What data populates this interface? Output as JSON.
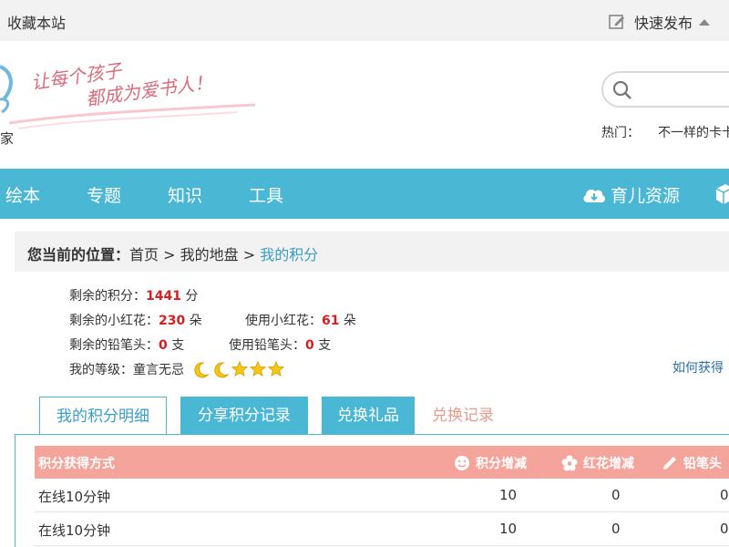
{
  "topbar": {
    "favorite": "收藏本站",
    "quick_post": "快速发布"
  },
  "header": {
    "logo_char": "家",
    "slogan_line1": "让每个孩子",
    "slogan_line2": "都成为爱书人！",
    "search_placeholder": "",
    "hot_label": "热门：",
    "hot_items": [
      "不一样的卡卡"
    ]
  },
  "nav": {
    "items": [
      "绘本",
      "专题",
      "知识",
      "工具"
    ],
    "resources": "育儿资源"
  },
  "breadcrumb": {
    "label": "您当前的位置：",
    "home": "首页",
    "sep": " > ",
    "parent": "我的地盘",
    "current": "我的积分"
  },
  "stats": {
    "points_label": "剩余的积分：",
    "points_value": "1441",
    "points_unit": " 分",
    "flowers_label": "剩余的小红花：",
    "flowers_value": "230",
    "flowers_unit": " 朵",
    "used_flowers_label": "使用小红花：",
    "used_flowers_value": "61",
    "used_flowers_unit": " 朵",
    "pencils_label": "剩余的铅笔头：",
    "pencils_value": "0",
    "pencils_unit": " 支",
    "used_pencils_label": "使用铅笔头：",
    "used_pencils_value": "0",
    "used_pencils_unit": " 支",
    "level_label": "我的等级：",
    "level_value": "童言无忌",
    "how_to": "如何获得"
  },
  "tabs": [
    "我的积分明细",
    "分享积分记录",
    "兑换礼品",
    "兑换记录"
  ],
  "table": {
    "headers": [
      "积分获得方式",
      "积分增减",
      "红花增减",
      "铅笔头"
    ],
    "rows": [
      [
        "在线10分钟",
        "10",
        "0",
        "0"
      ],
      [
        "在线10分钟",
        "10",
        "0",
        "0"
      ]
    ]
  },
  "colors": {
    "nav_bg": "#4ab8d4",
    "table_header_bg": "#f4a49a",
    "highlight_number": "#d42020",
    "link": "#3a9dc4"
  }
}
